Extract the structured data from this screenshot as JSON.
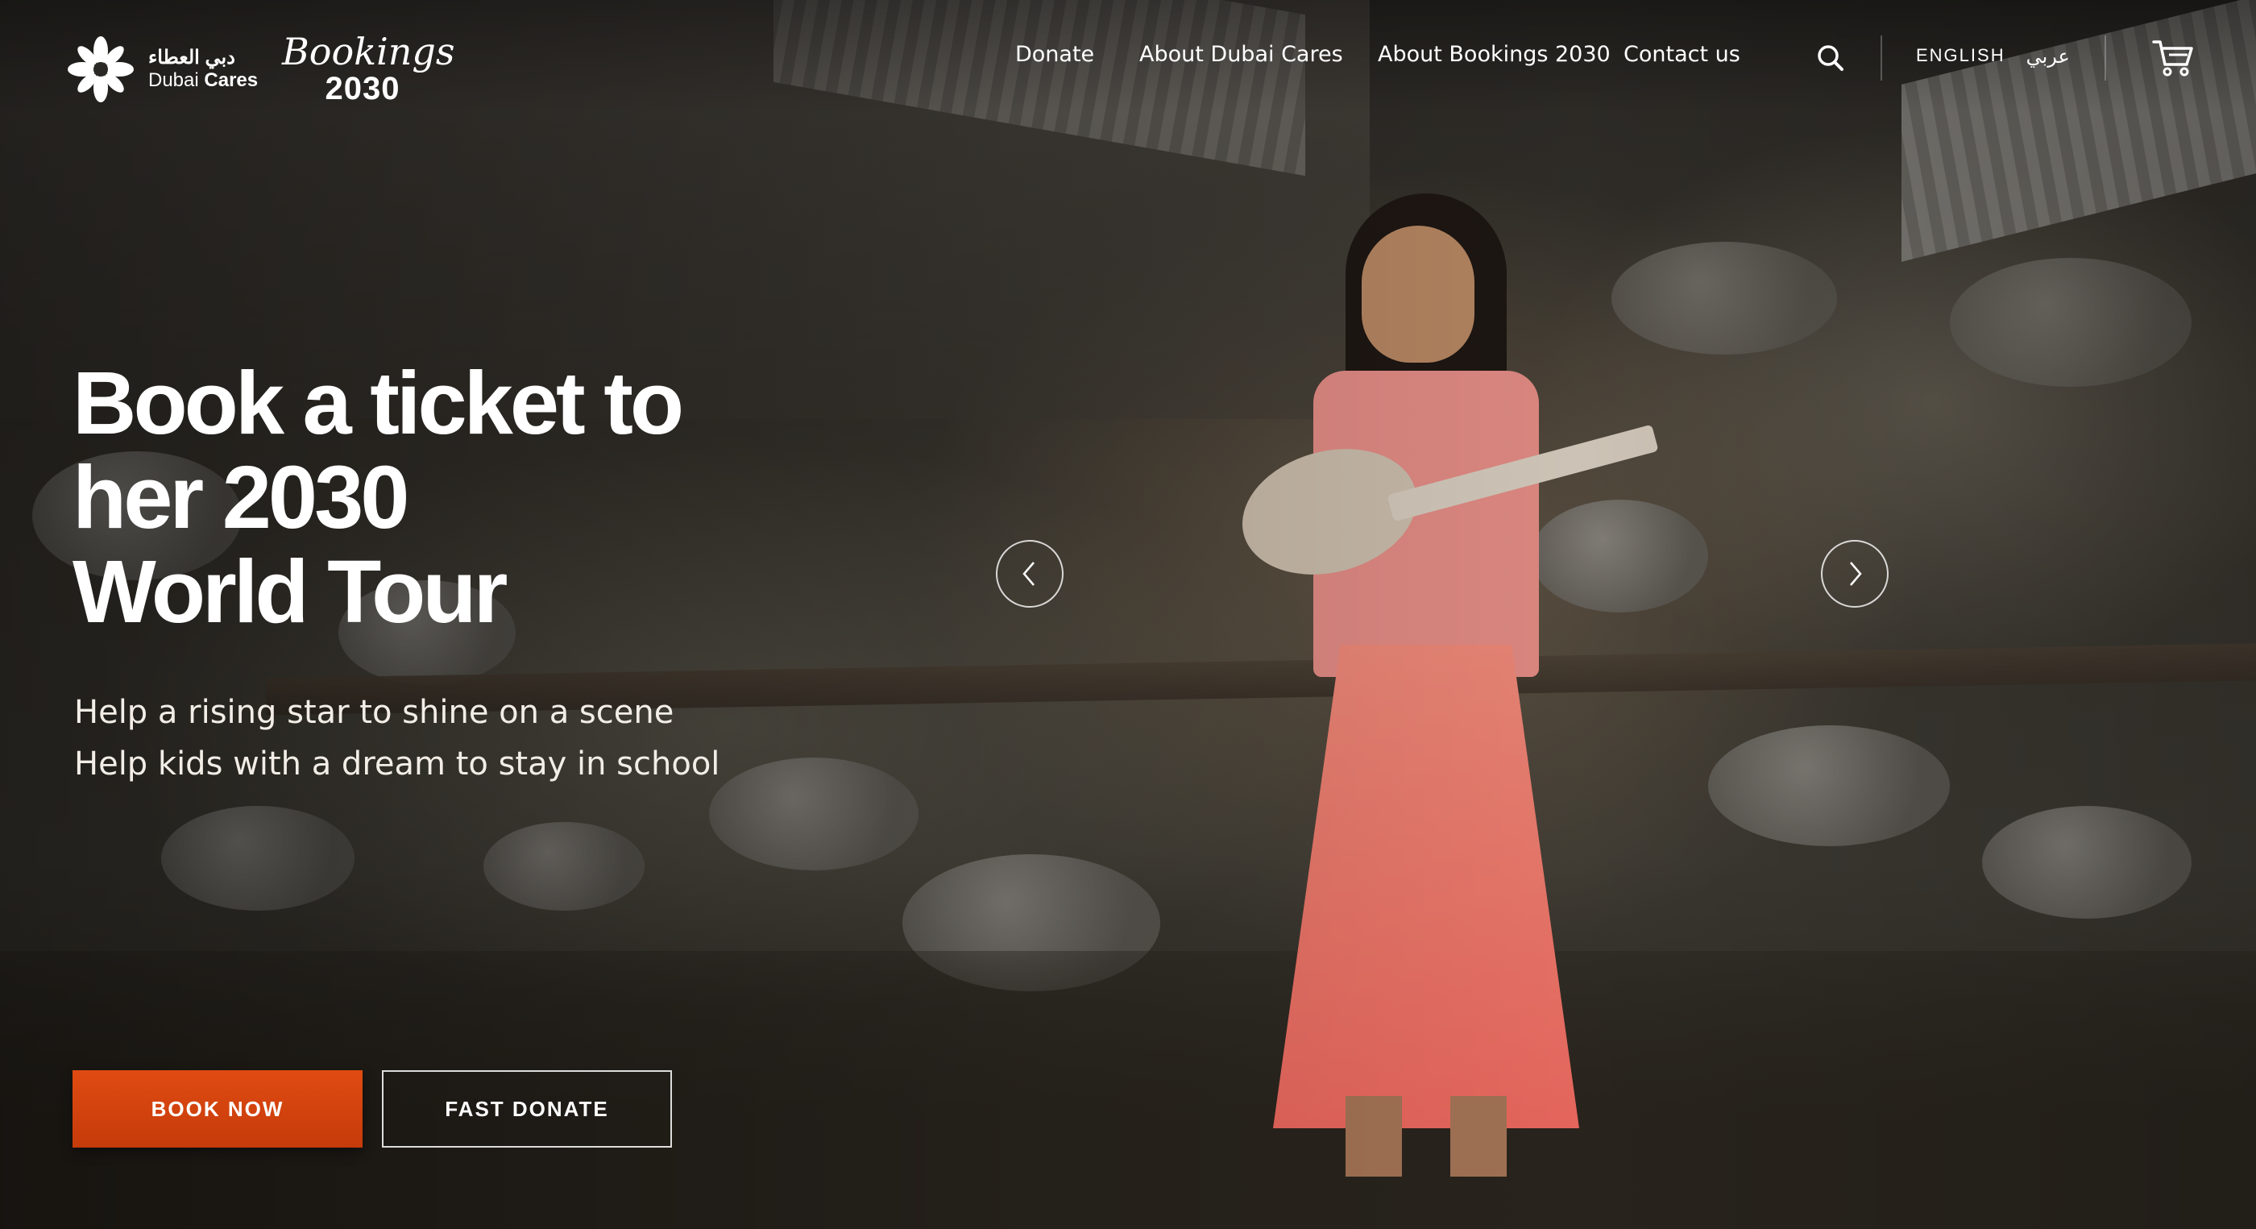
{
  "header": {
    "logo_dubai_cares": {
      "arabic": "دبي العطاء",
      "english_prefix": "Dubai",
      "english_bold": "Cares"
    },
    "logo_bookings": {
      "script": "Bookings",
      "year": "2030"
    },
    "nav": [
      {
        "label": "Donate"
      },
      {
        "label": "About Dubai Cares"
      },
      {
        "label": "About Bookings 2030"
      },
      {
        "label": "Contact us"
      }
    ],
    "language": {
      "english": "ENGLISH",
      "arabic": "عربي"
    },
    "icons": {
      "search": "search-icon",
      "cart": "cart-icon"
    }
  },
  "hero": {
    "headline": [
      "Book a ticket to",
      "her 2030",
      "World Tour"
    ],
    "sublines": [
      "Help a rising star to shine on a scene",
      "Help kids with a dream to stay in school"
    ],
    "buttons": {
      "book_now": "BOOK NOW",
      "fast_donate": "FAST DONATE"
    },
    "carousel": {
      "prev_icon": "chevron-left-icon",
      "next_icon": "chevron-right-icon"
    }
  },
  "colors": {
    "accent": "#d6430e",
    "text": "#ffffff"
  }
}
